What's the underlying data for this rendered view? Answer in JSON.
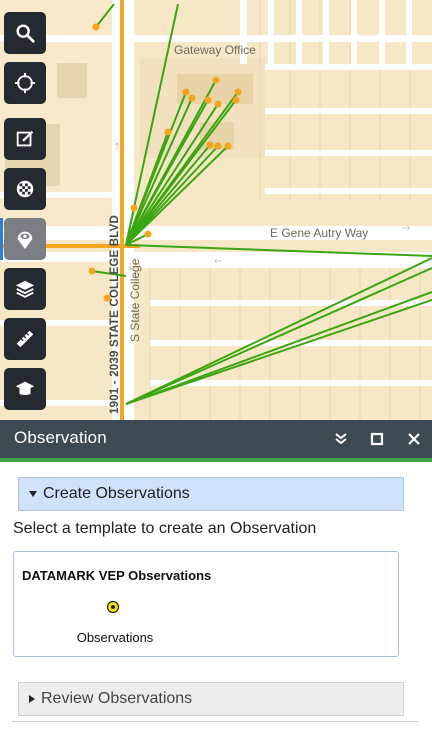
{
  "map": {
    "labels": {
      "gateway_office": "Gateway Office",
      "gene_autry": "E Gene Autry Way",
      "state_college_blvd": "1901 - 2039 STATE COLLEGE BLVD",
      "s_state_college": "S State College"
    }
  },
  "toolbar": {
    "items": [
      {
        "name": "search",
        "icon": "search-icon",
        "active": false
      },
      {
        "name": "locate",
        "icon": "crosshair-icon",
        "active": false
      },
      {
        "name": "edit",
        "icon": "edit-icon",
        "active": false
      },
      {
        "name": "basemap",
        "icon": "basemap-icon",
        "active": false
      },
      {
        "name": "observation",
        "icon": "eye-pin-icon",
        "active": true
      },
      {
        "name": "layers",
        "icon": "layers-icon",
        "active": false
      },
      {
        "name": "measure",
        "icon": "ruler-icon",
        "active": false
      },
      {
        "name": "other",
        "icon": "cap-icon",
        "active": false
      }
    ]
  },
  "panel": {
    "title": "Observation",
    "create_section": {
      "label": "Create Observations",
      "instruction": "Select a template to create an Observation",
      "template_group": "DATAMARK VEP Observations",
      "template_item": "Observations"
    },
    "review_section": {
      "label": "Review Observations"
    }
  },
  "colors": {
    "header_bg": "#3c4a54",
    "header_accent": "#3ea44a",
    "toolbar_bg": "#252a30",
    "accordion_active": "#cfe2f9",
    "observation_line": "#3aa611",
    "observation_point": "#f4a51d"
  }
}
